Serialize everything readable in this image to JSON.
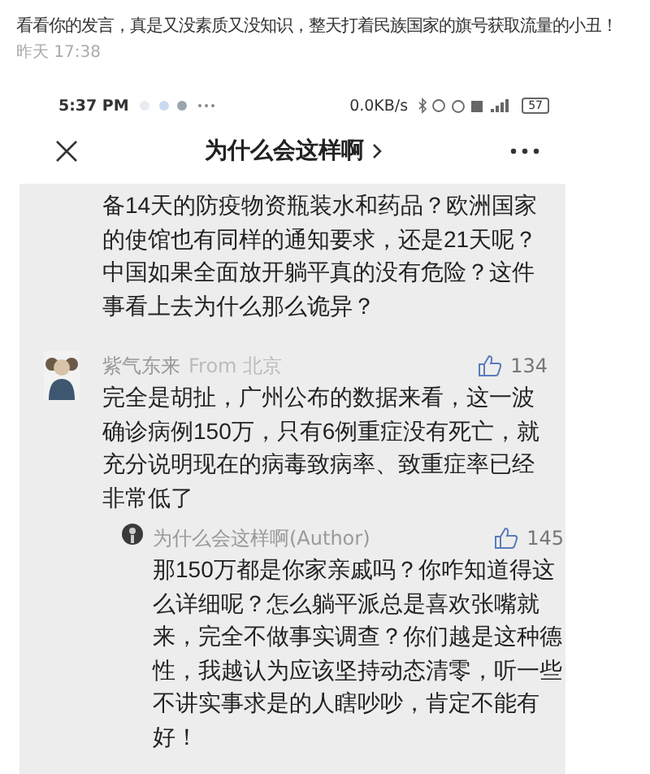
{
  "comment": {
    "text": "看看你的发言，真是又没素质又没知识，整天打着民族国家的旗号获取流量的小丑！",
    "time": "昨天 17:38"
  },
  "status_bar": {
    "time": "5:37 PM",
    "net_speed": "0.0KB/s",
    "battery": "57"
  },
  "header": {
    "title": "为什么会这样啊"
  },
  "article_tail": {
    "text": "备14天的防疫物资瓶装水和药品？欧洲国家的使馆也有同样的通知要求，还是21天呢？中国如果全面放开躺平真的没有危险？这件事看上去为什么那么诡异？"
  },
  "comments": [
    {
      "name": "紫气东来",
      "location": "From 北京",
      "likes": "134",
      "text": "完全是胡扯，广州公布的数据来看，这一波确诊病例150万，只有6例重症没有死亡，就充分说明现在的病毒致病率、致重症率已经非常低了",
      "replies": [
        {
          "name": "为什么会这样啊(Author)",
          "likes": "145",
          "text": "那150万都是你家亲戚吗？你咋知道得这么详细呢？怎么躺平派总是喜欢张嘴就来，完全不做事实调查？你们越是这种德性，我越认为应该坚持动态清零，听一些不讲实事求是的人瞎吵吵，肯定不能有好！"
        }
      ]
    }
  ]
}
